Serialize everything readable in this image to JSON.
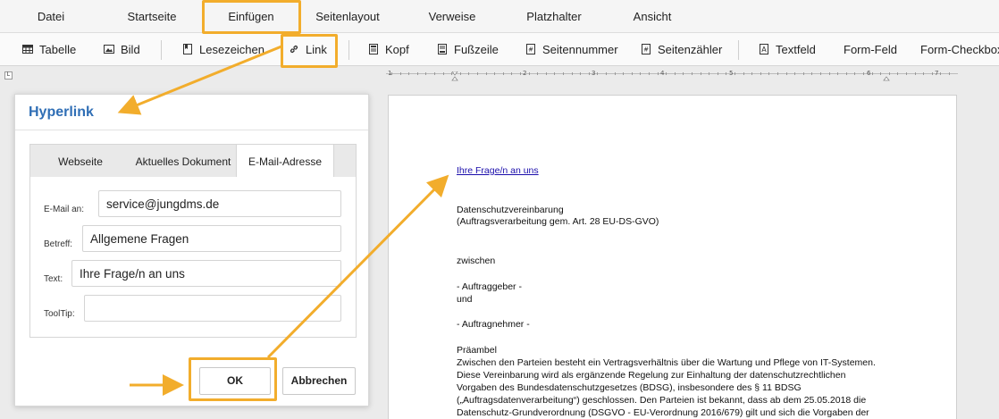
{
  "menu": [
    "Datei",
    "Startseite",
    "Einfügen",
    "Seitenlayout",
    "Verweise",
    "Platzhalter",
    "Ansicht"
  ],
  "toolbar": {
    "table": "Tabelle",
    "image": "Bild",
    "bookmark": "Lesezeichen",
    "link": "Link",
    "header": "Kopf",
    "footer": "Fußzeile",
    "page_number": "Seitennummer",
    "page_counter": "Seitenzähler",
    "textbox": "Textfeld",
    "form_field": "Form-Feld",
    "form_checkbox": "Form-Checkbox"
  },
  "ruler": {
    "corner": "L",
    "numbers": [
      "1",
      "2",
      "3",
      "4",
      "5",
      "6",
      "7"
    ]
  },
  "dialog": {
    "title": "Hyperlink",
    "tabs": [
      "Webseite",
      "Aktuelles Dokument",
      "E-Mail-Adresse"
    ],
    "active_tab": "E-Mail-Adresse",
    "fields": {
      "email_label": "E-Mail an:",
      "email_value": "service@jungdms.de",
      "subject_label": "Betreff:",
      "subject_value": "Allgemene Fragen",
      "text_label": "Text:",
      "text_value": "Ihre Frage/n an uns",
      "tooltip_label": "ToolTip:",
      "tooltip_value": ""
    },
    "ok": "OK",
    "cancel": "Abbrechen"
  },
  "document": {
    "link_text": "Ihre Frage/n an uns",
    "lines": [
      "Datenschutzvereinbarung",
      "(Auftragsverarbeitung gem. Art. 28 EU-DS-GVO)",
      "zwischen",
      "- Auftraggeber -",
      "und",
      "- Auftragnehmer -",
      "Präambel",
      "Zwischen den Parteien besteht ein Vertragsverhältnis über die Wartung und Pflege von IT-Systemen.",
      "Diese Vereinbarung wird als ergänzende Regelung zur Einhaltung der datenschutzrechtlichen",
      "Vorgaben des Bundesdatenschutzgesetzes (BDSG), insbesondere des § 11 BDSG",
      "(„Auftragsdatenverarbeitung“) geschlossen. Den Parteien ist bekannt, dass ab dem 25.05.2018 die",
      "Datenschutz-Grundverordnung (DSGVO - EU-Verordnung 2016/679) gilt und sich die Vorgaben der"
    ]
  },
  "colors": {
    "accent": "#f2ad2c",
    "title_blue": "#2f6eb5",
    "link_blue": "#1a0dab"
  }
}
